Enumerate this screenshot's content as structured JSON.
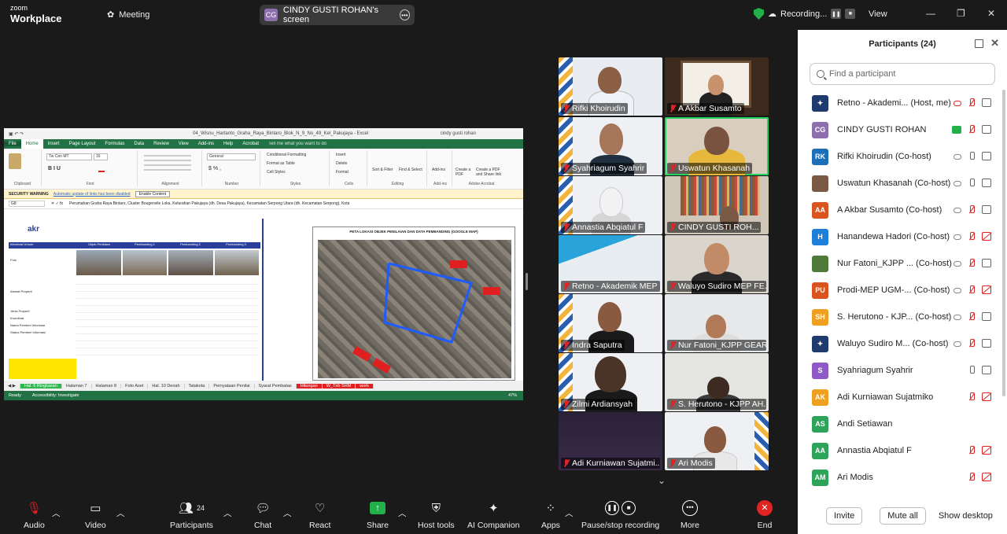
{
  "topbar": {
    "brand_line1": "zoom",
    "brand_line2": "Workplace",
    "meeting_label": "Meeting",
    "share_badge": "CG",
    "share_label": "CINDY GUSTI ROHAN's screen",
    "recording": "Recording...",
    "view": "View"
  },
  "excel": {
    "title": "04_Wisnu_Hartanto_Graha_Raya_Bintaro_Blok_N_9_No_49_Kel_Pakujaya - Excel",
    "user": "cindy gusti rohan",
    "menu": [
      "File",
      "Home",
      "Insert",
      "Page Layout",
      "Formulas",
      "Data",
      "Review",
      "View",
      "Add-ins",
      "Help",
      "Acrobat"
    ],
    "tell_me": "Tell me what you want to do",
    "font_name": "Tw Cen MT",
    "font_size": "16",
    "number_format": "General",
    "ribbon_groups": [
      "Clipboard",
      "Font",
      "Alignment",
      "Number",
      "Styles",
      "Cells",
      "Editing",
      "Add-ins",
      "Adobe Acrobat"
    ],
    "styles_items": [
      "Conditional Formatting",
      "Format as Table",
      "Cell Styles"
    ],
    "cells_items": [
      "Insert",
      "Delete",
      "Format"
    ],
    "editing_items": [
      "Sort & Filter",
      "Find & Select"
    ],
    "addins_label": "Add-ins",
    "acrobat_items": [
      "Create a PDF",
      "Create a PDF and Share link"
    ],
    "warning_label": "SECURITY WARNING",
    "warning_text": "Automatic update of links has been disabled",
    "warning_button": "Enable Content",
    "name_box": "G8",
    "formula": "Perumahan Graha Raya Bintaro, Cluster Bougenvile Loka, Kelurahan Pakujaya (dh. Desa Pakujaya), Kecamatan Serpong Utara (dh. Kecamatan Serpong), Kota",
    "map_title": "PETA LOKASI OBJEK PENILAIAN DAN DATA PEMBANDING (GOOGLE MAP)",
    "table_headers": [
      "Objek Penilaian",
      "Pembanding 1",
      "Pembanding 2",
      "Pembanding 3"
    ],
    "row_labels": [
      "Informasi Umum",
      "Foto",
      "Alamat Properti",
      "Jenis Properti",
      "Koordinat",
      "Nama Pemberi Informasi",
      "Status Pemberi Informasi"
    ],
    "sheet_tabs": [
      "Hal. 6 Ringkasan",
      "Halaman 7",
      "Halaman 8",
      "Foto Aset",
      "Hal. 10 Denah",
      "Tatakota",
      "Pernyataan Penilai",
      "Syarat Pembatas",
      "Hitungan",
      "W_Tnh SHM",
      "work"
    ],
    "status": {
      "ready": "Ready",
      "accessibility": "Accessibility: Investigate",
      "zoom": "47%"
    }
  },
  "gallery": [
    {
      "name": "Rifki Khoirudin"
    },
    {
      "name": "A Akbar Susamto"
    },
    {
      "name": "Syahriagum Syahrir"
    },
    {
      "name": "Uswatun Khasanah"
    },
    {
      "name": "Annastia Abqiatul F"
    },
    {
      "name": "CINDY GUSTI ROH..."
    },
    {
      "name": "Retno - Akademik MEP"
    },
    {
      "name": "Waluyo Sudiro MEP FE..."
    },
    {
      "name": "Indra Saputra"
    },
    {
      "name": "Nur Fatoni_KJPP GEAR"
    },
    {
      "name": "Zilmi Ardiansyah"
    },
    {
      "name": "S. Herutono - KJPP AH..."
    },
    {
      "name": "Adi Kurniawan Sujatmi..."
    },
    {
      "name": "Ari Modis"
    }
  ],
  "participants": {
    "title": "Participants (24)",
    "search_placeholder": "Find a participant",
    "list": [
      {
        "initials": "",
        "name": "Retno - Akademi... (Host, me)",
        "color": "#1f3a6e"
      },
      {
        "initials": "CG",
        "name": "CINDY GUSTI ROHAN",
        "color": "#8e6fae"
      },
      {
        "initials": "RK",
        "name": "Rifki Khoirudin (Co-host)",
        "color": "#1d6fb8"
      },
      {
        "initials": "",
        "name": "Uswatun Khasanah (Co-host)",
        "color": "#7a5a44"
      },
      {
        "initials": "AA",
        "name": "A Akbar Susamto (Co-host)",
        "color": "#d9541e"
      },
      {
        "initials": "H",
        "name": "Hanandewa Hadori (Co-host)",
        "color": "#1d7fd8"
      },
      {
        "initials": "",
        "name": "Nur Fatoni_KJPP ... (Co-host)",
        "color": "#4f7a3a"
      },
      {
        "initials": "PU",
        "name": "Prodi-MEP UGM-... (Co-host)",
        "color": "#d9541e"
      },
      {
        "initials": "SH",
        "name": "S. Herutono - KJP... (Co-host)",
        "color": "#f0a020"
      },
      {
        "initials": "",
        "name": "Waluyo Sudiro M... (Co-host)",
        "color": "#1f3a6e"
      },
      {
        "initials": "S",
        "name": "Syahriagum Syahrir",
        "color": "#8e5ac8"
      },
      {
        "initials": "AK",
        "name": "Adi Kurniawan Sujatmiko",
        "color": "#f0a020"
      },
      {
        "initials": "AS",
        "name": "Andi Setiawan",
        "color": "#2ea35a"
      },
      {
        "initials": "AA",
        "name": "Annastia Abqiatul F",
        "color": "#2ea35a"
      },
      {
        "initials": "AM",
        "name": "Ari Modis",
        "color": "#2ea35a"
      }
    ],
    "invite": "Invite",
    "mute_all": "Mute all",
    "show_desktop": "Show desktop"
  },
  "toolbar": {
    "audio": "Audio",
    "video": "Video",
    "participants": "Participants",
    "participants_count": "24",
    "chat": "Chat",
    "react": "React",
    "share": "Share",
    "host_tools": "Host tools",
    "ai": "AI Companion",
    "apps": "Apps",
    "pause_rec": "Pause/stop recording",
    "more": "More",
    "end": "End"
  }
}
